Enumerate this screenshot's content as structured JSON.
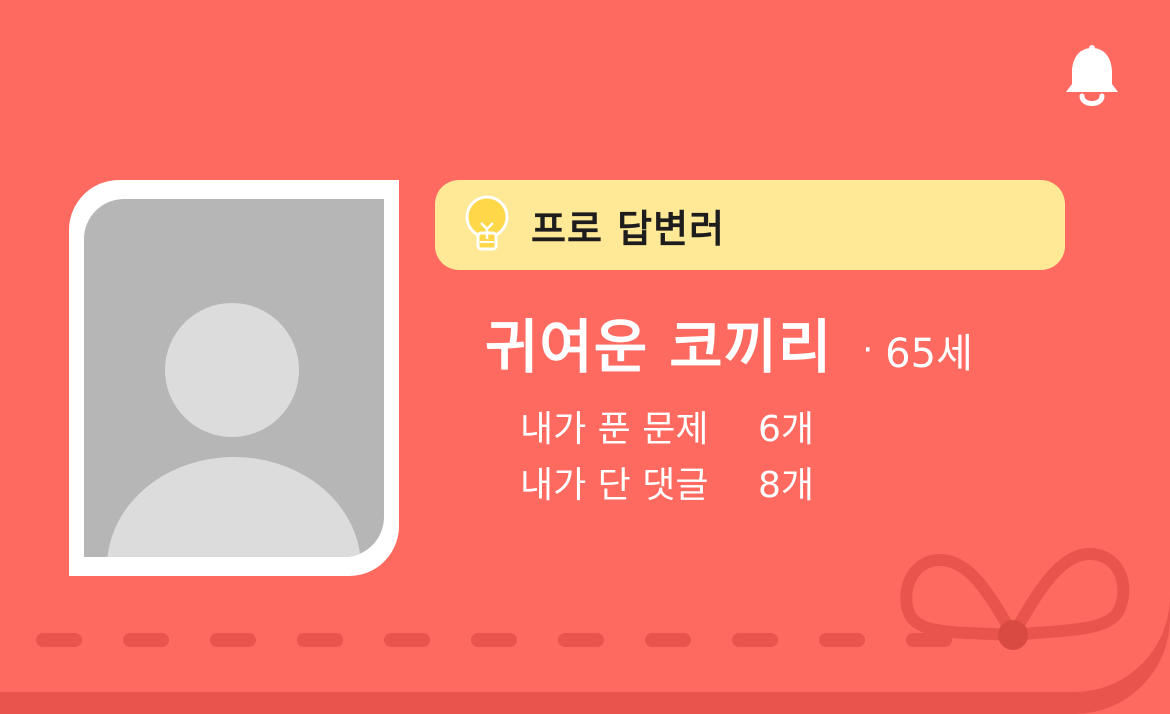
{
  "header": {
    "bell_icon": "bell-icon"
  },
  "badge": {
    "icon": "lightbulb-icon",
    "label": "프로 답변러",
    "color": "#ffe896"
  },
  "profile": {
    "avatar": "default-avatar-icon",
    "name": "귀여운 코끼리",
    "separator": "·",
    "age": "65세"
  },
  "stats": [
    {
      "label": "내가 푼 문제",
      "value": "6개"
    },
    {
      "label": "내가 단 댓글",
      "value": "8개"
    }
  ],
  "theme": {
    "background": "#ff6a60",
    "accent_dark": "#e9554d",
    "text": "#ffffff"
  }
}
